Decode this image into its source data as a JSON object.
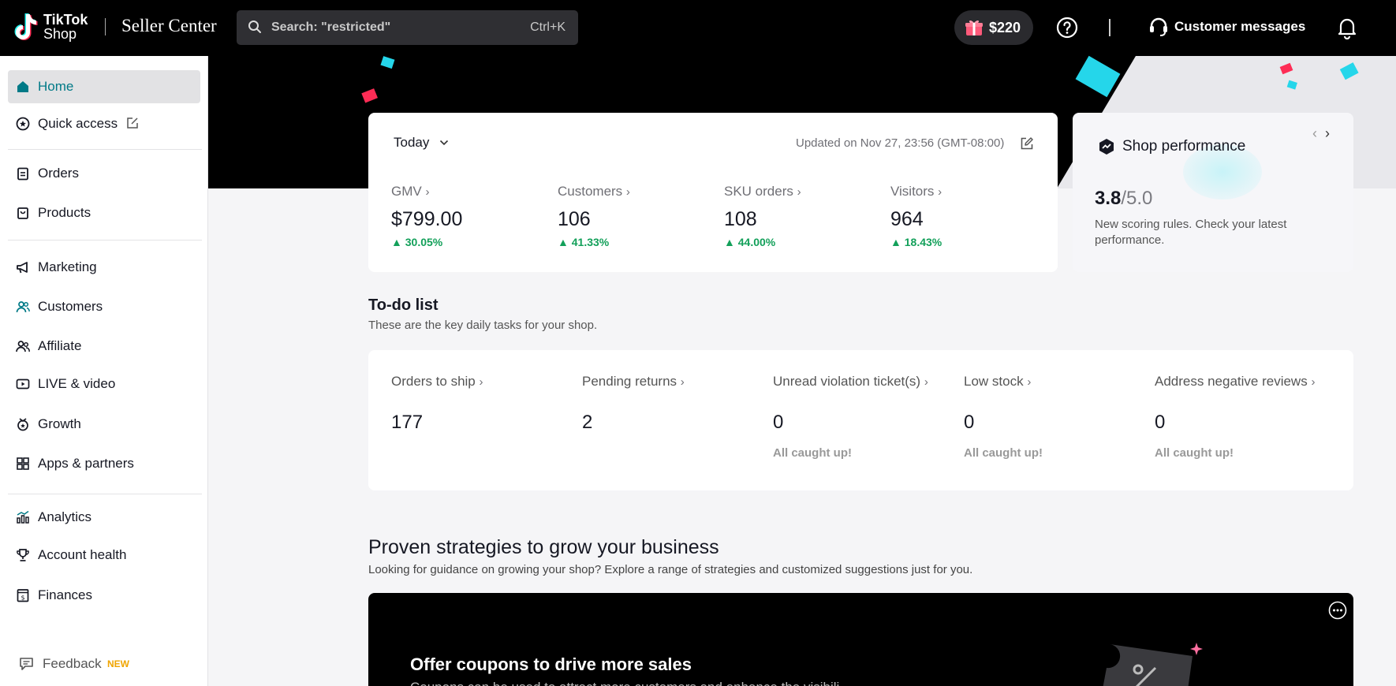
{
  "topbar": {
    "logo_brand": "TikTok",
    "logo_shop": "Shop",
    "product_name": "Seller Center",
    "search_placeholder": "Search: \"restricted\"",
    "search_shortcut": "Ctrl+K",
    "bonus_amount": "$220",
    "customer_messages_label": "Customer messages"
  },
  "sidebar": {
    "items": [
      {
        "label": "Home",
        "icon": "home-icon"
      },
      {
        "label": "Quick access",
        "icon": "star-icon"
      },
      {
        "label": "Orders",
        "icon": "clipboard-icon"
      },
      {
        "label": "Products",
        "icon": "bag-icon"
      },
      {
        "label": "Marketing",
        "icon": "megaphone-icon"
      },
      {
        "label": "Customers",
        "icon": "customers-icon"
      },
      {
        "label": "Affiliate",
        "icon": "affiliate-icon"
      },
      {
        "label": "LIVE & video",
        "icon": "video-icon"
      },
      {
        "label": "Growth",
        "icon": "growth-icon"
      },
      {
        "label": "Apps & partners",
        "icon": "apps-icon"
      },
      {
        "label": "Analytics",
        "icon": "analytics-icon"
      },
      {
        "label": "Account health",
        "icon": "trophy-icon"
      },
      {
        "label": "Finances",
        "icon": "finances-icon"
      }
    ],
    "feedback_label": "Feedback",
    "feedback_badge": "NEW"
  },
  "stats": {
    "period": "Today",
    "updated": "Updated on Nov 27, 23:56 (GMT-08:00)",
    "metrics": [
      {
        "name": "GMV",
        "value": "$799.00",
        "change": "30.05%"
      },
      {
        "name": "Customers",
        "value": "106",
        "change": "41.33%"
      },
      {
        "name": "SKU orders",
        "value": "108",
        "change": "44.00%"
      },
      {
        "name": "Visitors",
        "value": "964",
        "change": "18.43%"
      }
    ]
  },
  "performance": {
    "title": "Shop performance",
    "score": "3.8",
    "max": "/5.0",
    "description": "New scoring rules. Check your latest performance."
  },
  "todo": {
    "title": "To-do list",
    "subtitle": "These are the key daily tasks for your shop.",
    "items": [
      {
        "name": "Orders to ship",
        "value": "177",
        "note": ""
      },
      {
        "name": "Pending returns",
        "value": "2",
        "note": ""
      },
      {
        "name": "Unread violation ticket(s)",
        "value": "0",
        "note": "All caught up!"
      },
      {
        "name": "Low stock",
        "value": "0",
        "note": "All caught up!"
      },
      {
        "name": "Address negative reviews",
        "value": "0",
        "note": "All caught up!"
      }
    ]
  },
  "growth": {
    "title": "Proven strategies to grow your business",
    "subtitle": "Looking for guidance on growing your shop? Explore a range of strategies and customized suggestions just for you.",
    "coupon_title": "Offer coupons to drive more sales",
    "coupon_desc": "Coupons can be used to attract more customers and enhance the visibili"
  },
  "colors": {
    "accent": "#007a87",
    "positive": "#13a05a",
    "confetti_cyan": "#25d6ea",
    "confetti_red": "#fe2c55",
    "badge_new": "#f0a500"
  }
}
